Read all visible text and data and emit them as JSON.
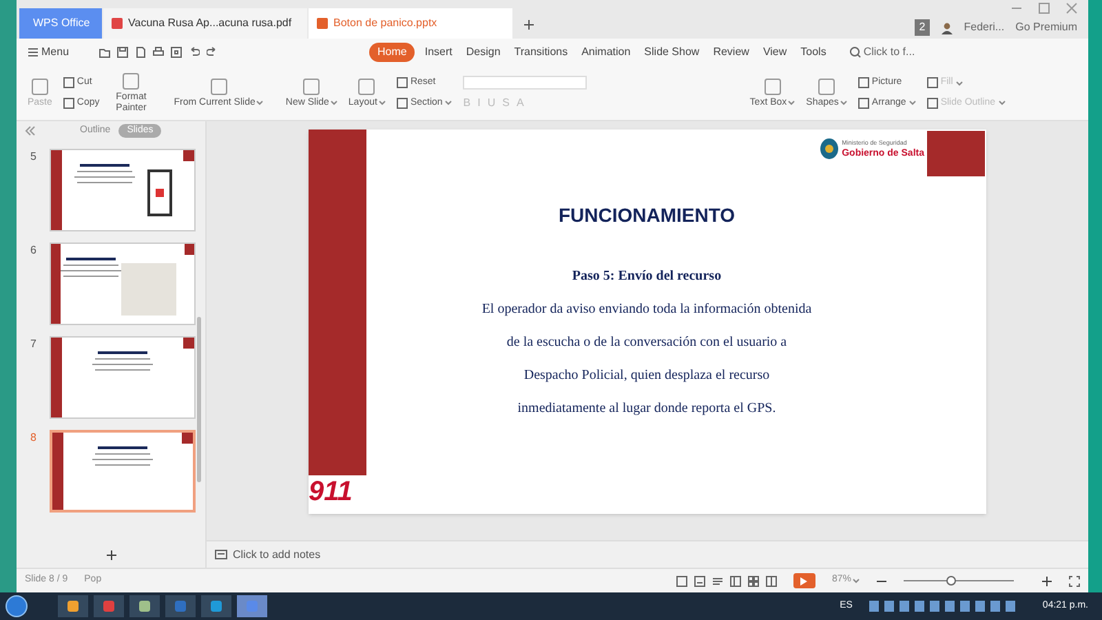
{
  "doc_tabs": [
    {
      "label": "WPS Office",
      "kind": "home",
      "selected": false
    },
    {
      "label": "Vacuna Rusa Ap...acuna rusa.pdf",
      "kind": "pdf",
      "selected": false
    },
    {
      "label": "Boton de panico.pptx",
      "kind": "pptx",
      "selected": true
    }
  ],
  "title_bar": {
    "badge": "2",
    "user": "Federi...",
    "premium": "Go Premium"
  },
  "menu": {
    "label": "Menu"
  },
  "ribbon_tabs": [
    {
      "label": "Home",
      "selected": true
    },
    {
      "label": "Insert",
      "selected": false
    },
    {
      "label": "Design",
      "selected": false
    },
    {
      "label": "Transitions",
      "selected": false
    },
    {
      "label": "Animation",
      "selected": false
    },
    {
      "label": "Slide Show",
      "selected": false
    },
    {
      "label": "Review",
      "selected": false
    },
    {
      "label": "View",
      "selected": false
    },
    {
      "label": "Tools",
      "selected": false
    }
  ],
  "search": {
    "placeholder": "Click to f..."
  },
  "format_buttons": [
    "B",
    "I",
    "U",
    "S",
    "A"
  ],
  "ribbon": {
    "paste": "Paste",
    "cut": "Cut",
    "copy": "Copy",
    "format_painter": "Format Painter",
    "from_current": "From Current Slide",
    "new_slide": "New Slide",
    "layout": "Layout",
    "reset": "Reset",
    "section": "Section",
    "text_box": "Text Box",
    "shapes": "Shapes",
    "picture": "Picture",
    "arrange": "Arrange",
    "fill": "Fill",
    "slide_outline": "Slide Outline"
  },
  "pane_tabs": [
    {
      "label": "Outline",
      "selected": false
    },
    {
      "label": "Slides",
      "selected": true
    }
  ],
  "thumbnails": [
    {
      "number": "5",
      "kind": "phone",
      "selected": false
    },
    {
      "number": "6",
      "kind": "map",
      "selected": false
    },
    {
      "number": "7",
      "kind": "text",
      "selected": false
    },
    {
      "number": "8",
      "kind": "text",
      "selected": true
    }
  ],
  "slide": {
    "org_small": "Ministerio de Seguridad",
    "org": "Gobierno de Salta",
    "title": "FUNCIONAMIENTO",
    "subtitle": "Paso 5: Envío del recurso",
    "lines": [
      "El operador da aviso enviando toda la información obtenida",
      "de la escucha o de la conversación con el usuario a",
      "Despacho Policial, quien desplaza el recurso",
      "inmediatamente al lugar donde reporta el GPS."
    ],
    "logo": "911"
  },
  "notes": {
    "placeholder": "Click to add notes"
  },
  "status_bar": {
    "slide": "Slide 8 / 9",
    "theme": "Pop",
    "zoom": "87%",
    "zoom_slider": {
      "level": 0.42
    }
  },
  "taskbar": {
    "language": "ES",
    "time": "04:21 p.m."
  }
}
